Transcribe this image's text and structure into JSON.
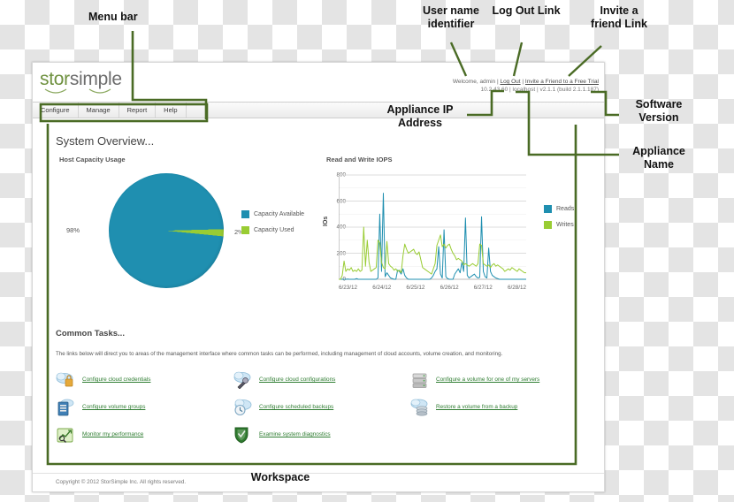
{
  "annotations": {
    "menu_bar": "Menu bar",
    "user_name": "User name\nidentifier",
    "log_out": "Log Out Link",
    "invite_friend": "Invite a\nfriend Link",
    "appliance_ip": "Appliance IP\nAddress",
    "software_version": "Software\nVersion",
    "appliance_name": "Appliance\nName",
    "workspace": "Workspace"
  },
  "brand": {
    "logo_part1": "stor",
    "logo_part2": "simple"
  },
  "header": {
    "welcome_text": "Welcome, admin | ",
    "log_out_link": "Log Out",
    "separator": " | ",
    "invite_link": "Invite a Friend to a Free Trial",
    "status_line": "10.2.43.60 | localhost | v2.1.1 (build 2.1.1.187)"
  },
  "menu": {
    "items": [
      {
        "label": "Configure"
      },
      {
        "label": "Manage"
      },
      {
        "label": "Report"
      },
      {
        "label": "Help"
      }
    ]
  },
  "overview": {
    "title": "System Overview...",
    "host_capacity_label": "Host Capacity Usage",
    "iops_label": "Read and Write IOPS"
  },
  "tasks": {
    "title": "Common Tasks...",
    "description": "The links below will direct you to areas of the management interface where common tasks can be performed, including management of cloud accounts, volume creation, and monitoring.",
    "items": [
      {
        "label": "Configure cloud credentials",
        "icon": "cloud-lock-icon"
      },
      {
        "label": "Configure cloud configurations",
        "icon": "cloud-wrench-icon"
      },
      {
        "label": "Configure a volume for one of my servers",
        "icon": "server-stack-icon"
      },
      {
        "label": "Configure volume groups",
        "icon": "volume-group-icon"
      },
      {
        "label": "Configure scheduled backups",
        "icon": "cloud-clock-icon"
      },
      {
        "label": "Restore a volume from a backup",
        "icon": "cloud-restore-icon"
      },
      {
        "label": "Monitor my performance",
        "icon": "performance-chart-icon"
      },
      {
        "label": "Examine system diagnostics",
        "icon": "shield-icon"
      },
      {
        "label": "",
        "icon": ""
      }
    ]
  },
  "footer": {
    "copyright": "Copyright © 2012 StorSimple Inc. All rights reserved."
  },
  "colors": {
    "teal": "#1f8fb0",
    "green": "#99cc33",
    "brand_green": "#6f9140",
    "annotation_green": "#4a6b25",
    "link_green": "#2f7d32"
  },
  "chart_data": [
    {
      "type": "pie",
      "title": "Host Capacity Usage",
      "labels": [
        "Capacity Available",
        "Capacity Used"
      ],
      "values": [
        98,
        2
      ],
      "value_labels": [
        "98%",
        "2%"
      ],
      "colors": [
        "#1f8fb0",
        "#99cc33"
      ],
      "legend": "right"
    },
    {
      "type": "line",
      "title": "Read and Write IOPS",
      "xlabel": "",
      "ylabel": "IOs",
      "ylim": [
        0,
        800
      ],
      "yticks": [
        0,
        200,
        400,
        600,
        800
      ],
      "xticks": [
        "6/23/12",
        "6/24/12",
        "6/25/12",
        "6/26/12",
        "6/27/12",
        "6/28/12"
      ],
      "grid": true,
      "legend": "right",
      "series": [
        {
          "name": "Reads",
          "color": "#1f8fb0",
          "values": [
            0,
            0,
            0,
            0,
            0,
            2,
            0,
            0,
            0,
            0,
            5,
            0,
            0,
            0,
            0,
            0,
            0,
            0,
            0,
            0,
            0,
            0,
            10,
            500,
            60,
            660,
            20,
            50,
            30,
            10,
            5,
            0,
            0,
            70,
            60,
            40,
            80,
            30,
            10,
            0,
            0,
            0,
            0,
            0,
            0,
            0,
            0,
            0,
            0,
            0,
            0,
            0,
            10,
            30,
            60,
            80,
            250,
            40,
            10,
            380,
            20,
            5,
            0,
            0,
            0,
            40,
            60,
            80,
            50,
            130,
            60,
            470,
            30,
            10,
            20,
            30,
            40,
            20,
            10,
            15,
            480,
            60,
            20,
            10,
            240,
            60,
            30,
            20,
            10,
            5,
            0,
            0,
            0,
            0,
            0,
            0,
            0,
            0,
            0,
            0,
            0,
            0,
            0,
            0,
            0,
            0
          ]
        },
        {
          "name": "Writes",
          "color": "#99cc33",
          "values": [
            0,
            0,
            30,
            140,
            60,
            80,
            70,
            90,
            60,
            70,
            60,
            80,
            60,
            70,
            400,
            100,
            300,
            130,
            60,
            70,
            80,
            90,
            300,
            280,
            130,
            90,
            80,
            290,
            120,
            100,
            90,
            70,
            80,
            60,
            70,
            50,
            180,
            270,
            230,
            200,
            210,
            220,
            230,
            200,
            190,
            210,
            150,
            90,
            80,
            70,
            60,
            50,
            40,
            80,
            120,
            260,
            300,
            340,
            250,
            270,
            240,
            260,
            270,
            230,
            200,
            180,
            150,
            160,
            150,
            140,
            110,
            120,
            110,
            100,
            110,
            120,
            110,
            100,
            120,
            270,
            260,
            120,
            110,
            100,
            110,
            90,
            110,
            120,
            100,
            110,
            100,
            90,
            80,
            60,
            70,
            80,
            70,
            90,
            80,
            70,
            60,
            80,
            70,
            60,
            50,
            50
          ]
        }
      ]
    }
  ]
}
